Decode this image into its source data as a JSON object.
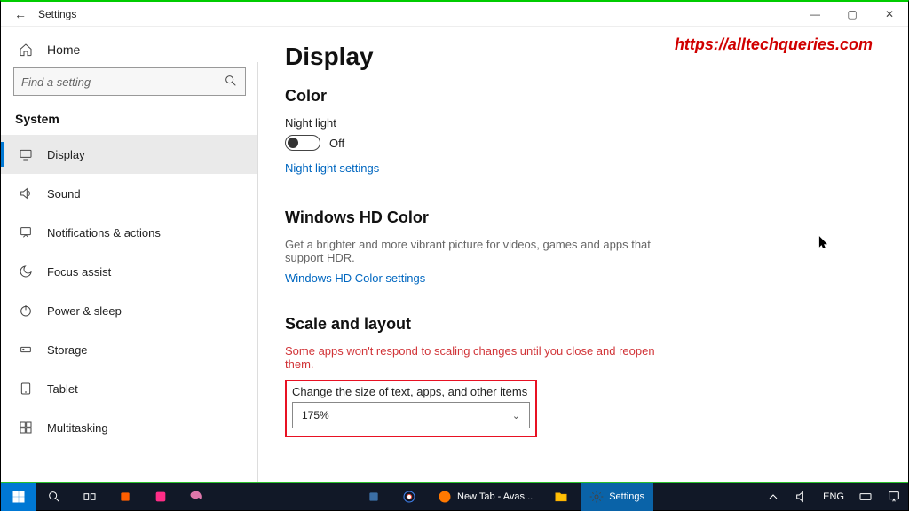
{
  "titlebar": {
    "title": "Settings",
    "back": "←",
    "minimize": "—",
    "maximize": "▢",
    "close": "✕"
  },
  "watermark": "https://alltechqueries.com",
  "sidebar": {
    "home": "Home",
    "search_placeholder": "Find a setting",
    "category": "System",
    "items": [
      {
        "label": "Display",
        "active": true
      },
      {
        "label": "Sound"
      },
      {
        "label": "Notifications & actions"
      },
      {
        "label": "Focus assist"
      },
      {
        "label": "Power & sleep"
      },
      {
        "label": "Storage"
      },
      {
        "label": "Tablet"
      },
      {
        "label": "Multitasking"
      }
    ]
  },
  "page": {
    "title": "Display",
    "color": {
      "heading": "Color",
      "night_label": "Night light",
      "night_state": "Off",
      "night_link": "Night light settings"
    },
    "hd": {
      "heading": "Windows HD Color",
      "desc": "Get a brighter and more vibrant picture for videos, games and apps that support HDR.",
      "link": "Windows HD Color settings"
    },
    "scale": {
      "heading": "Scale and layout",
      "warn": "Some apps won't respond to scaling changes until you close and reopen them.",
      "select_label": "Change the size of text, apps, and other items",
      "select_value": "175%"
    }
  },
  "taskbar": {
    "items": [
      {
        "label": "New Tab - Avas..."
      },
      {
        "label": "Settings",
        "active": true
      }
    ],
    "lang": "ENG"
  }
}
